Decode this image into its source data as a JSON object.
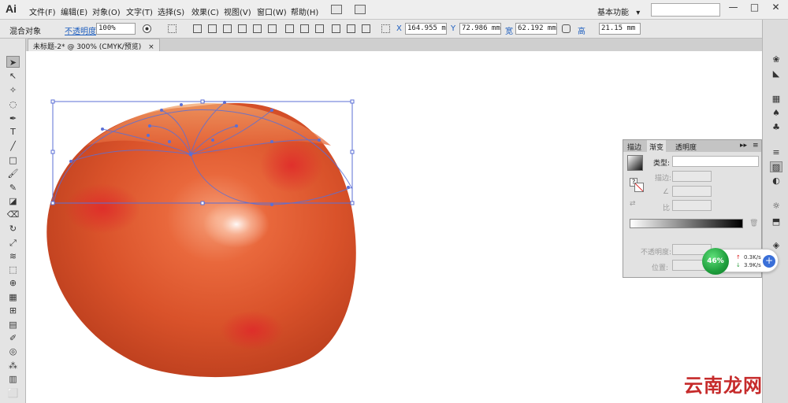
{
  "app": {
    "logo": "Ai"
  },
  "menu": [
    "文件(F)",
    "编辑(E)",
    "对象(O)",
    "文字(T)",
    "选择(S)",
    "效果(C)",
    "视图(V)",
    "窗口(W)",
    "帮助(H)"
  ],
  "workspace": {
    "label": "基本功能",
    "arrow": "▾"
  },
  "window_controls": {
    "minimize": "—",
    "maximize": "□",
    "close": "✕"
  },
  "control_bar": {
    "selection": "混合对象",
    "opacity_label": "不透明度",
    "opacity_value": "100%",
    "x_label": "X",
    "x_value": "164.955 m",
    "y_label": "Y",
    "y_value": "72.986 mm",
    "w_label": "宽",
    "w_value": "62.192 mm",
    "h_label": "高",
    "h_value": "21.15 mm"
  },
  "document_tab": {
    "title": "未标题-2* @ 300% (CMYK/预览)",
    "close": "×"
  },
  "gradient_panel": {
    "tabs": [
      "描边",
      "渐变",
      "透明度"
    ],
    "active_tab": "渐变",
    "type_label": "类型:",
    "stroke_label": "描边:",
    "angle_label": "∠",
    "aspect_label": "比",
    "opacity_label": "不透明度:",
    "location_label": "位置:"
  },
  "network_widget": {
    "percent": "46%",
    "upload": "0.3K/s",
    "download": "3.9K/s",
    "plus": "+"
  },
  "watermark": "云南龙网"
}
